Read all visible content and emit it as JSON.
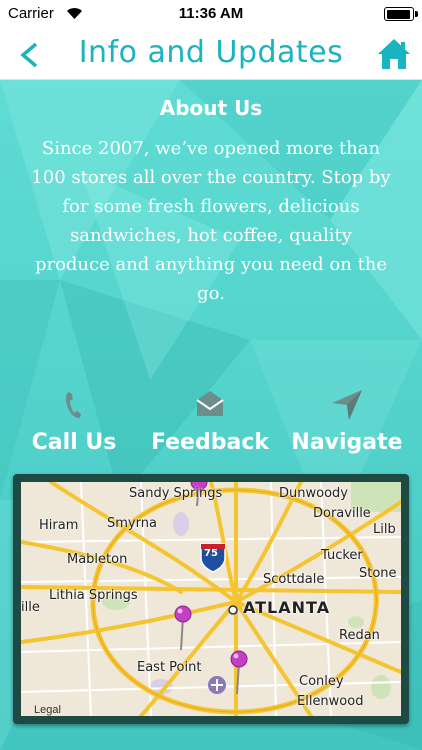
{
  "status_bar": {
    "carrier": "Carrier",
    "time": "11:36 AM"
  },
  "nav": {
    "title": "Info and Updates",
    "back_icon": "back-chevron-icon",
    "home_icon": "home-icon",
    "accent": "#1ab4c1"
  },
  "about": {
    "title": "About Us",
    "body": "Since 2007, we’ve opened more than 100 stores all over the country. Stop by for some fresh flowers, delicious sandwiches, hot coffee, quality produce and anything you need on the go."
  },
  "actions": [
    {
      "label": "Call Us",
      "icon": "phone-icon"
    },
    {
      "label": "Feedback",
      "icon": "envelope-icon"
    },
    {
      "label": "Navigate",
      "icon": "navigation-arrow-icon"
    }
  ],
  "map": {
    "places": {
      "sandy_springs": "Sandy Springs",
      "dunwoody": "Dunwoody",
      "doraville": "Doraville",
      "hiram": "Hiram",
      "smyrna": "Smyrna",
      "lilb": "Lilb",
      "mableton": "Mableton",
      "tucker": "Tucker",
      "scottdale": "Scottdale",
      "stone": "Stone",
      "lithia_springs": "Lithia Springs",
      "atlanta": "ATLANTA",
      "ille": "ille",
      "redan": "Redan",
      "east_point": "East Point",
      "conley": "Conley",
      "ellenwood": "Ellenwood"
    },
    "highway_shield": "75",
    "legal": "Legal"
  }
}
